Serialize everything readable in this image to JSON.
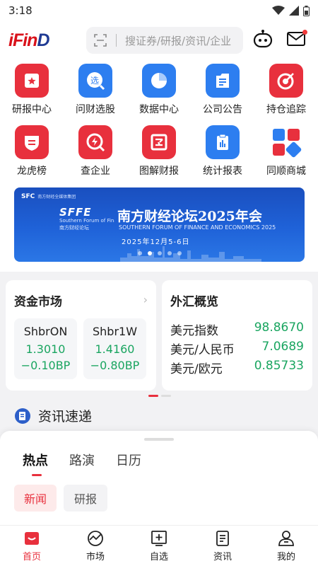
{
  "status": {
    "time": "3:18"
  },
  "header": {
    "logo_main": "iFin",
    "logo_tail": "D",
    "search_placeholder": "搜证券/研报/资讯/企业"
  },
  "grid": [
    {
      "label": "研报中心",
      "icon": "report-star-icon",
      "color": "red"
    },
    {
      "label": "问财选股",
      "icon": "stock-select-icon",
      "color": "blue"
    },
    {
      "label": "数据中心",
      "icon": "pie-chart-icon",
      "color": "blue"
    },
    {
      "label": "公司公告",
      "icon": "announcement-icon",
      "color": "blue"
    },
    {
      "label": "持仓追踪",
      "icon": "target-icon",
      "color": "red"
    },
    {
      "label": "龙虎榜",
      "icon": "shield-list-icon",
      "color": "red"
    },
    {
      "label": "查企业",
      "icon": "enterprise-search-icon",
      "color": "red"
    },
    {
      "label": "图解财报",
      "icon": "chart-report-icon",
      "color": "red"
    },
    {
      "label": "统计报表",
      "icon": "clipboard-stats-icon",
      "color": "blue"
    },
    {
      "label": "同顺商城",
      "icon": "store-grid-icon",
      "color": "multi"
    }
  ],
  "banner": {
    "org": "SFC",
    "org_sub": "南方财经全媒体集团",
    "logo_text": "SFFE",
    "logo_sub1": "Southern Forum of Finance and Economics",
    "logo_sub2": "南方财经论坛",
    "title": "南方财经论坛2025年会",
    "subtitle_en": "SOUTHERN FORUM OF FINANCE AND ECONOMICS 2025",
    "date": "2025年12月5-6日",
    "slide_count": 5,
    "active_slide": 1
  },
  "money_market": {
    "title": "资金市场",
    "items": [
      {
        "name": "ShbrON",
        "value": "1.3010",
        "change": "−0.10BP"
      },
      {
        "name": "Shbr1W",
        "value": "1.4160",
        "change": "−0.80BP"
      }
    ]
  },
  "fx": {
    "title": "外汇概览",
    "rows": [
      {
        "name": "美元指数",
        "value": "98.8670"
      },
      {
        "name": "美元/人民币",
        "value": "7.0689"
      },
      {
        "name": "美元/欧元",
        "value": "0.85733"
      }
    ]
  },
  "news": {
    "title": "资讯速递",
    "tabs": [
      "热点",
      "路演",
      "日历"
    ],
    "chips": [
      "新闻",
      "研报"
    ]
  },
  "nav": [
    {
      "label": "首页",
      "icon": "home-icon",
      "active": true
    },
    {
      "label": "市场",
      "icon": "market-icon",
      "active": false
    },
    {
      "label": "自选",
      "icon": "watchlist-icon",
      "active": false
    },
    {
      "label": "资讯",
      "icon": "news-icon",
      "active": false
    },
    {
      "label": "我的",
      "icon": "profile-icon",
      "active": false
    }
  ],
  "colors": {
    "accent_red": "#e8303d",
    "accent_blue": "#2d7ef0",
    "up_green": "#1aa560"
  }
}
